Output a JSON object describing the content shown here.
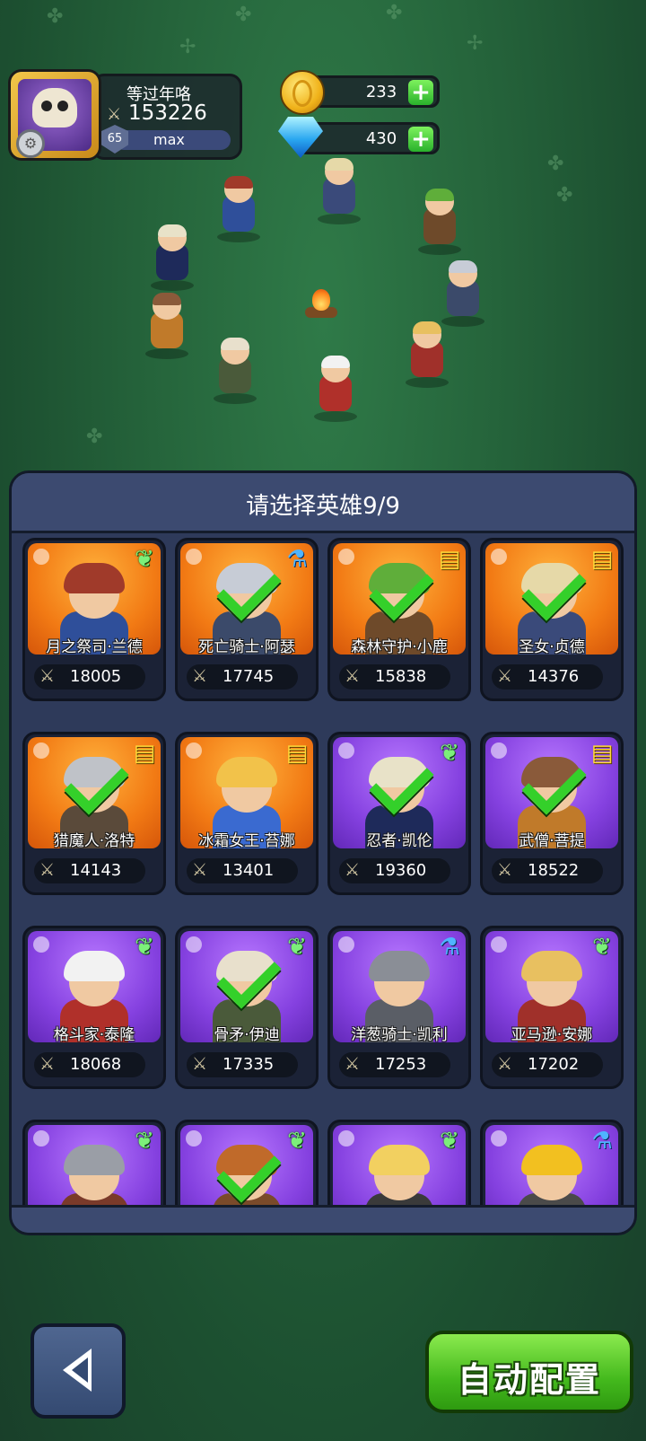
{
  "player": {
    "name": "等过年咯",
    "power": "153226",
    "level": "65",
    "level_status": "max",
    "avatar_icon": "skull-crown-icon"
  },
  "currencies": {
    "gold": {
      "value": "233",
      "icon": "gold-coin-icon"
    },
    "diamond": {
      "value": "430",
      "icon": "diamond-gem-icon"
    }
  },
  "panel": {
    "title": "请选择英雄9/9"
  },
  "heroes": [
    {
      "name": "月之祭司·兰德",
      "power": "18005",
      "rarity": "orange",
      "class": "wing",
      "selected": false,
      "hair": "#a03a2a",
      "outfit": "#2f4f9a"
    },
    {
      "name": "死亡骑士·阿瑟",
      "power": "17745",
      "rarity": "orange",
      "class": "potion",
      "selected": true,
      "hair": "#c7ccd6",
      "outfit": "#3b4a6a"
    },
    {
      "name": "森林守护·小鹿",
      "power": "15838",
      "rarity": "orange",
      "class": "book",
      "selected": true,
      "hair": "#5fae3a",
      "outfit": "#6e4a2a"
    },
    {
      "name": "圣女·贞德",
      "power": "14376",
      "rarity": "orange",
      "class": "book",
      "selected": true,
      "hair": "#e6d9a8",
      "outfit": "#3a4a7a"
    },
    {
      "name": "猎魔人·洛特",
      "power": "14143",
      "rarity": "orange",
      "class": "book",
      "selected": true,
      "hair": "#bfc2c8",
      "outfit": "#5a4a3a"
    },
    {
      "name": "冰霜女王·苔娜",
      "power": "13401",
      "rarity": "orange",
      "class": "book",
      "selected": false,
      "hair": "#f2c24a",
      "outfit": "#3a6ad0"
    },
    {
      "name": "忍者·凯伦",
      "power": "19360",
      "rarity": "purple",
      "class": "wing",
      "selected": true,
      "hair": "#e8e2c8",
      "outfit": "#1e2a5a"
    },
    {
      "name": "武僧·菩提",
      "power": "18522",
      "rarity": "purple",
      "class": "book",
      "selected": true,
      "hair": "#8a5a3a",
      "outfit": "#c07a2a"
    },
    {
      "name": "格斗家·泰隆",
      "power": "18068",
      "rarity": "purple",
      "class": "wing",
      "selected": false,
      "hair": "#f2f2f2",
      "outfit": "#b0302a"
    },
    {
      "name": "骨矛·伊迪",
      "power": "17335",
      "rarity": "purple",
      "class": "wing",
      "selected": true,
      "hair": "#e8e0cc",
      "outfit": "#4a5a3a"
    },
    {
      "name": "洋葱骑士·凯利",
      "power": "17253",
      "rarity": "purple",
      "class": "potion",
      "selected": false,
      "hair": "#8a8e96",
      "outfit": "#5a5e66"
    },
    {
      "name": "亚马逊·安娜",
      "power": "17202",
      "rarity": "purple",
      "class": "wing",
      "selected": false,
      "hair": "#e8c060",
      "outfit": "#a0302a"
    },
    {
      "name": "",
      "power": "",
      "rarity": "purple",
      "class": "wing",
      "selected": false,
      "hair": "#9a9ea6",
      "outfit": "#7a3a2a"
    },
    {
      "name": "",
      "power": "",
      "rarity": "purple",
      "class": "wing",
      "selected": true,
      "hair": "#c06a2a",
      "outfit": "#7a4a2a"
    },
    {
      "name": "",
      "power": "",
      "rarity": "purple",
      "class": "wing",
      "selected": false,
      "hair": "#f2d060",
      "outfit": "#3a3a3a"
    },
    {
      "name": "",
      "power": "",
      "rarity": "purple",
      "class": "potion",
      "selected": false,
      "hair": "#f2c020",
      "outfit": "#4a4a4a"
    }
  ],
  "buttons": {
    "back_icon": "back-arrow-icon",
    "auto_label": "自动配置"
  },
  "colors": {
    "orange_card": "#f27a14",
    "purple_card": "#8541e0",
    "check": "#34d02a",
    "auto_button": "#44b91d"
  }
}
